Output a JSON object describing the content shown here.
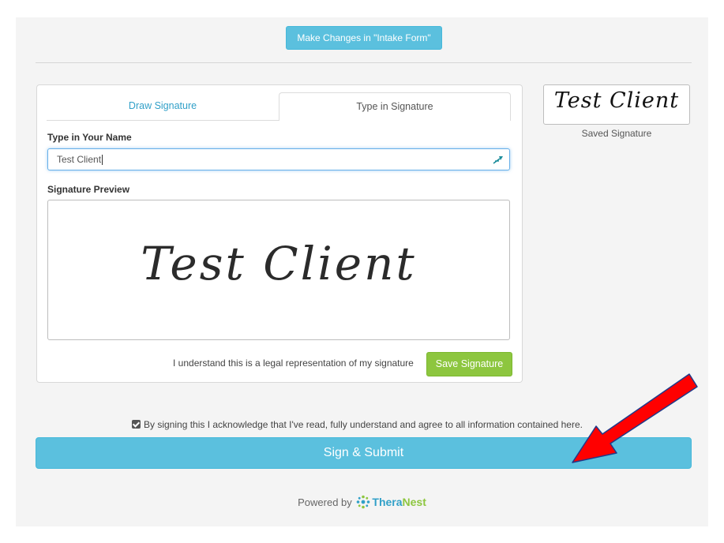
{
  "header": {
    "make_changes_label": "Make Changes in \"Intake Form\""
  },
  "tabs": [
    {
      "label": "Draw Signature",
      "active": false
    },
    {
      "label": "Type in Signature",
      "active": true
    }
  ],
  "form": {
    "name_label": "Type in Your Name",
    "name_value": "Test Client",
    "preview_label": "Signature Preview",
    "preview_text": "Test Client",
    "legal_text": "I understand this is a legal representation of my signature",
    "save_label": "Save Signature"
  },
  "saved": {
    "signature_text": "Test Client",
    "label": "Saved Signature"
  },
  "acknowledge": {
    "checked": true,
    "text": "By signing this I acknowledge that I've read, fully understand and agree to all information contained here."
  },
  "submit_label": "Sign & Submit",
  "footer": {
    "powered_by": "Powered by",
    "brand_part1": "Thera",
    "brand_part2": "Nest"
  },
  "colors": {
    "info": "#5bc0de",
    "success": "#8dc63f",
    "arrow": "#ff0000"
  },
  "icons": {
    "pen": "pen-icon",
    "logo": "theranest-logo-icon",
    "arrow": "red-arrow-annotation"
  }
}
